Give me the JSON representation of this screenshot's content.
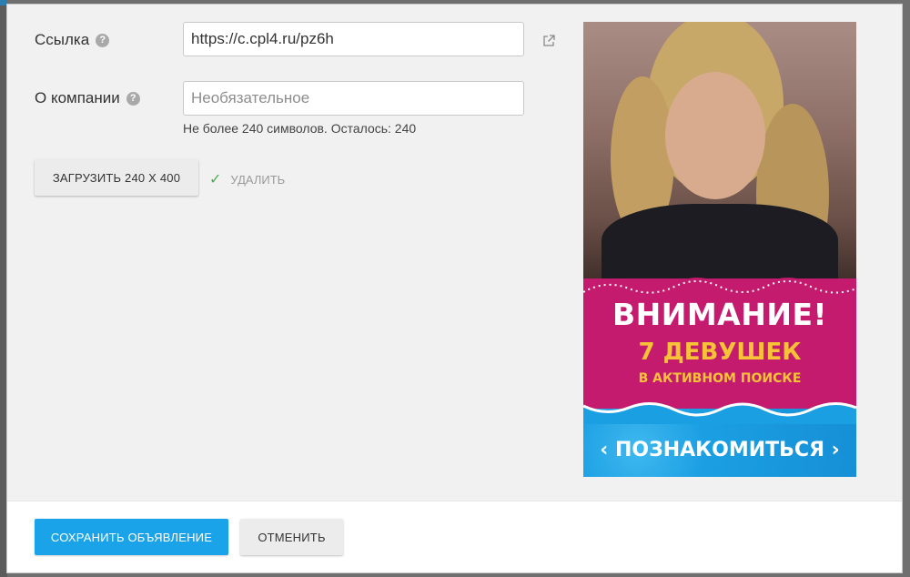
{
  "form": {
    "link": {
      "label": "Ссылка",
      "value": "https://c.cpl4.ru/pz6h"
    },
    "company": {
      "label": "О компании",
      "placeholder": "Необязательное",
      "hint": "Не более 240 символов. Осталось: 240"
    },
    "upload_label": "ЗАГРУЗИТЬ 240 X 400",
    "delete_label": "УДАЛИТЬ"
  },
  "banner": {
    "title": "ВНИМАНИЕ!",
    "subtitle": "7 ДЕВУШЕК",
    "subtitle2": "В АКТИВНОМ ПОИСКЕ",
    "cta": "‹ ПОЗНАКОМИТЬСЯ ›"
  },
  "footer": {
    "save_label": "СОХРАНИТЬ ОБЪЯВЛЕНИЕ",
    "cancel_label": "ОТМЕНИТЬ"
  },
  "colors": {
    "primary": "#1aa3e8",
    "banner_pink": "#c41b6e",
    "banner_blue": "#1b9fe3",
    "banner_yellow": "#f6c238",
    "check_green": "#4cae4c"
  },
  "icons": {
    "help": "?",
    "external_link": "external-link-icon",
    "check": "✓"
  }
}
